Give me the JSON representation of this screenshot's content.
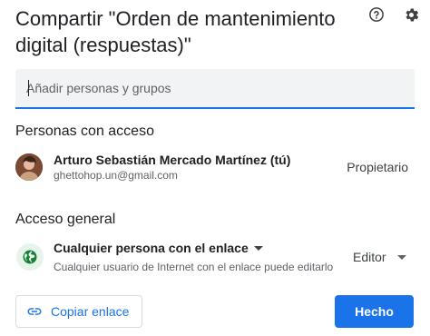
{
  "dialog": {
    "title": "Compartir \"Orden de mantenimiento digital (respuestas)\"",
    "icons": {
      "help": "help-circle-icon",
      "settings": "gear-icon"
    }
  },
  "add_people": {
    "placeholder": "Añadir personas y grupos"
  },
  "people_with_access": {
    "section_title": "Personas con acceso",
    "people": [
      {
        "name": "Arturo Sebastián Mercado Martínez (tú)",
        "email": "ghettohop.un@gmail.com",
        "role": "Propietario"
      }
    ]
  },
  "general_access": {
    "section_title": "Acceso general",
    "access_level": "Cualquier persona con el enlace",
    "description": "Cualquier usuario de Internet con el enlace puede editarlo",
    "role": "Editor",
    "icon": "globe-icon",
    "icon_bg": "#e6f4ea",
    "icon_color": "#188038"
  },
  "footer": {
    "copy_link_label": "Copiar enlace",
    "done_label": "Hecho"
  },
  "colors": {
    "accent": "#1a73e8",
    "text": "#202124",
    "secondary_text": "#5f6368"
  }
}
